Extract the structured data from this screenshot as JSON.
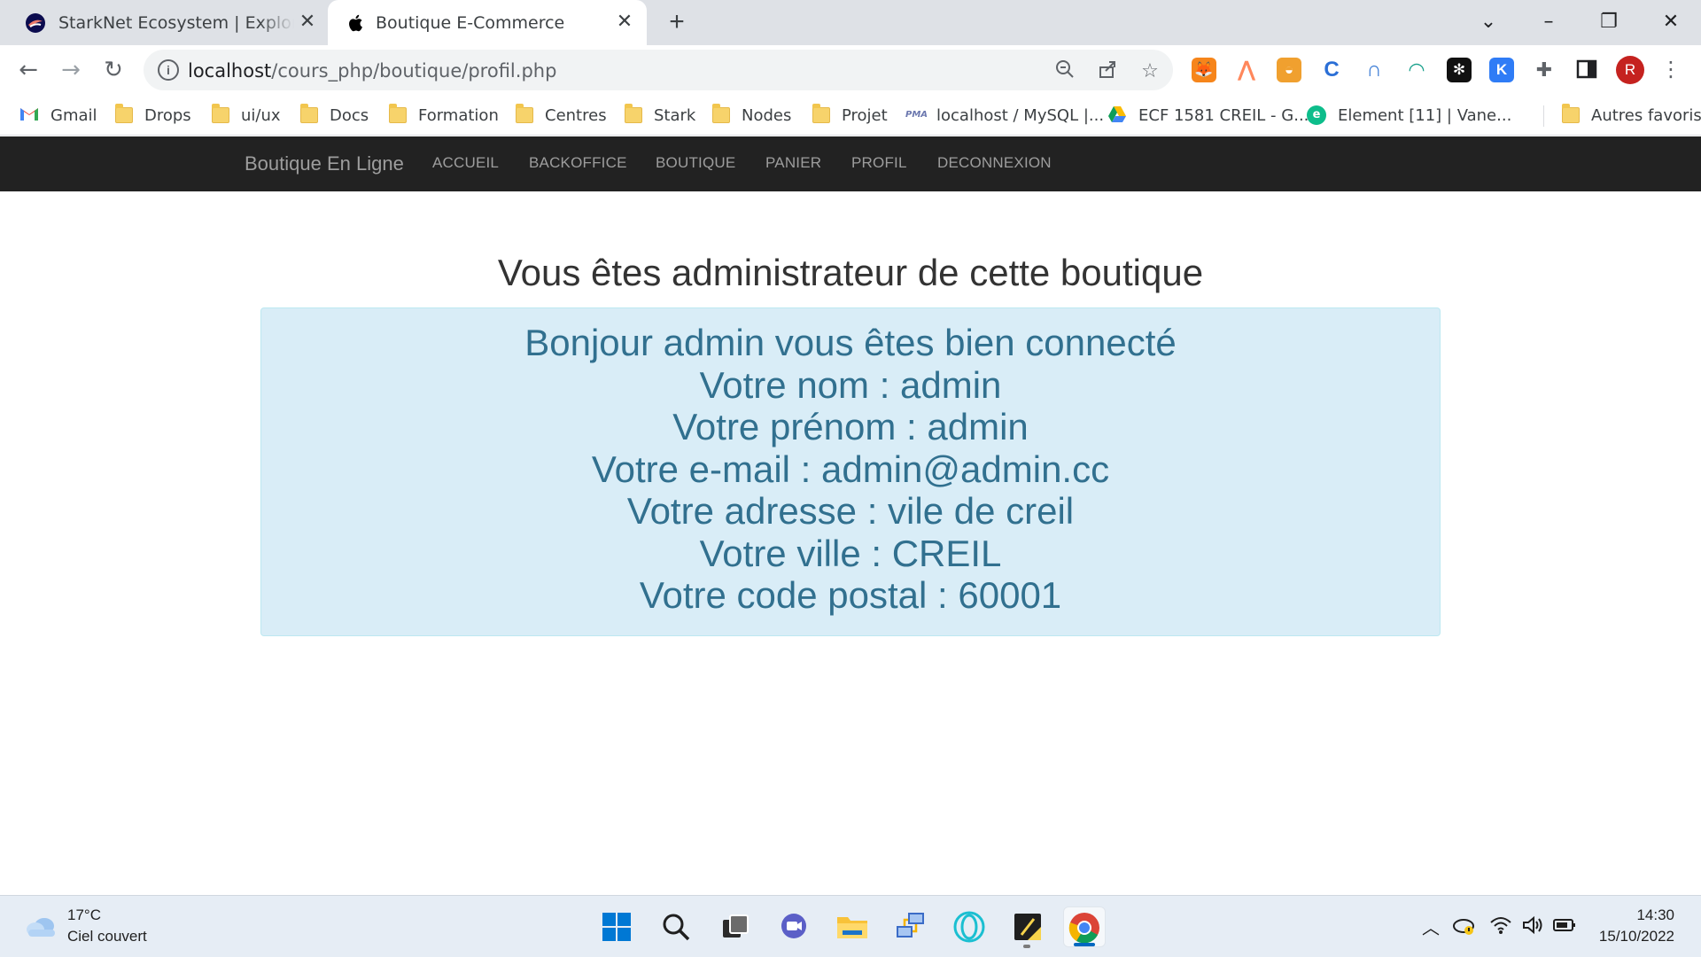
{
  "browser": {
    "tabs": [
      {
        "title": "StarkNet Ecosystem | Explore projects",
        "favicon": "starknet-logo",
        "active": false
      },
      {
        "title": "Boutique E-Commerce",
        "favicon": "apple-logo",
        "active": true
      }
    ],
    "new_tab_icon": "plus-icon",
    "window_controls": [
      "chevron-down-icon",
      "minimize-icon",
      "restore-icon",
      "close-icon"
    ],
    "address_bar": {
      "host": "localhost",
      "path": "/cours_php/boutique/profil.php"
    },
    "extensions": [
      "metamask-icon",
      "argent-icon",
      "braavos-icon",
      "extension-c-icon",
      "extension-arc-icon",
      "extension-rainbow-icon",
      "extension-snowflake-icon",
      "extension-k-icon",
      "puzzle-icon",
      "sidebar-icon"
    ],
    "profile_initial": "R",
    "bookmarks": [
      {
        "label": "Gmail",
        "icon": "gmail-icon"
      },
      {
        "label": "Drops",
        "icon": "folder-icon"
      },
      {
        "label": "ui/ux",
        "icon": "folder-icon"
      },
      {
        "label": "Docs",
        "icon": "folder-icon"
      },
      {
        "label": "Formation",
        "icon": "folder-icon"
      },
      {
        "label": "Centres",
        "icon": "folder-icon"
      },
      {
        "label": "Stark",
        "icon": "folder-icon"
      },
      {
        "label": "Nodes",
        "icon": "folder-icon"
      },
      {
        "label": "Projet",
        "icon": "folder-icon"
      },
      {
        "label": "localhost / MySQL |...",
        "icon": "phpmyadmin-icon"
      },
      {
        "label": "ECF 1581 CREIL - G...",
        "icon": "google-drive-icon"
      },
      {
        "label": "Element [11] | Vane...",
        "icon": "element-icon"
      }
    ],
    "other_bookmarks": "Autres favoris"
  },
  "site": {
    "brand": "Boutique En Ligne",
    "nav": [
      "ACCUEIL",
      "BACKOFFICE",
      "BOUTIQUE",
      "PANIER",
      "PROFIL",
      "DECONNEXION"
    ]
  },
  "main": {
    "heading": "Vous êtes administrateur de cette boutique",
    "info_lines": [
      "Bonjour admin vous êtes bien connecté",
      "Votre nom : admin",
      "Votre prénom : admin",
      "Votre e-mail : admin@admin.cc",
      "Votre adresse : vile de creil",
      "Votre ville : CREIL",
      "Votre code postal : 60001"
    ]
  },
  "taskbar": {
    "weather": {
      "temp": "17°C",
      "desc": "Ciel couvert"
    },
    "apps": [
      "windows-start-icon",
      "search-icon",
      "task-view-icon",
      "chat-icon",
      "file-explorer-icon",
      "network-app-icon",
      "opera-icon",
      "sticky-notes-icon",
      "chrome-icon"
    ],
    "tray": [
      "chevron-up-icon",
      "onedrive-icon",
      "wifi-icon",
      "volume-icon",
      "battery-icon"
    ],
    "time": "14:30",
    "date": "15/10/2022"
  },
  "colors": {
    "navbar_bg": "#222222",
    "nav_text": "#9d9d9d",
    "alert_bg": "#d9edf7",
    "alert_text": "#31708f",
    "alert_border": "#bce8f1"
  }
}
